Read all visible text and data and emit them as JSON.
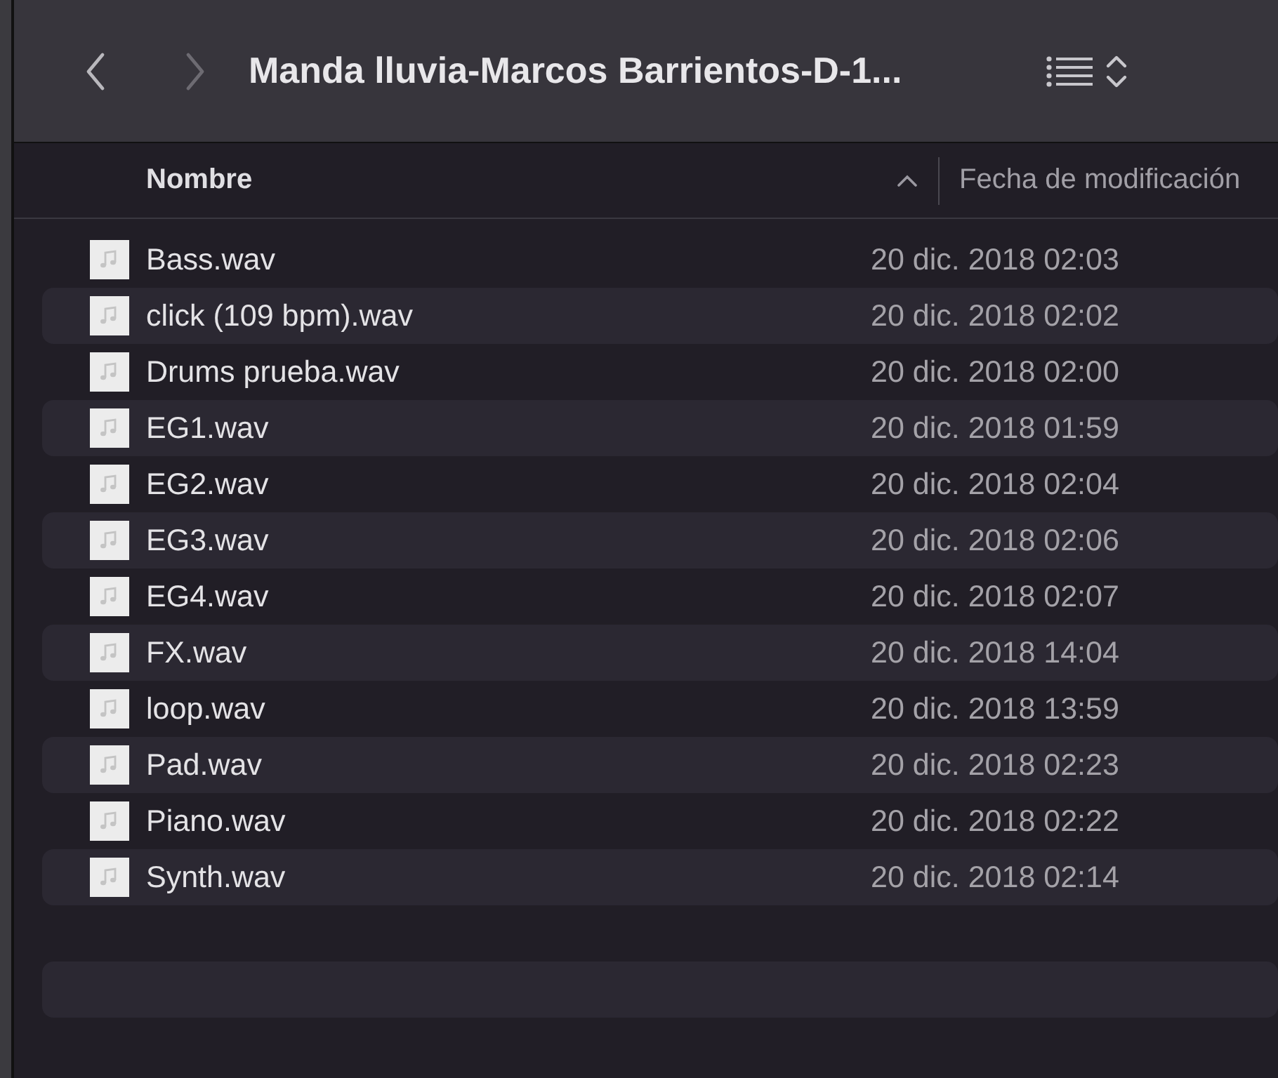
{
  "toolbar": {
    "back": {
      "disabled": false
    },
    "forward": {
      "disabled": true
    },
    "title": "Manda lluvia-Marcos Barrientos-D-1..."
  },
  "columns": [
    {
      "label": "Nombre",
      "sorted": true
    },
    {
      "label": "Fecha de modificación",
      "sorted": false
    }
  ],
  "rows": [
    {
      "name": "Bass.wav",
      "date": "20 dic. 2018 02:03"
    },
    {
      "name": "click (109 bpm).wav",
      "date": "20 dic. 2018 02:02"
    },
    {
      "name": "Drums prueba.wav",
      "date": "20 dic. 2018 02:00"
    },
    {
      "name": "EG1.wav",
      "date": "20 dic. 2018 01:59"
    },
    {
      "name": "EG2.wav",
      "date": "20 dic. 2018 02:04"
    },
    {
      "name": "EG3.wav",
      "date": "20 dic. 2018 02:06"
    },
    {
      "name": "EG4.wav",
      "date": "20 dic. 2018 02:07"
    },
    {
      "name": "FX.wav",
      "date": "20 dic. 2018 14:04"
    },
    {
      "name": "loop.wav",
      "date": "20 dic. 2018 13:59"
    },
    {
      "name": "Pad.wav",
      "date": "20 dic. 2018 02:23"
    },
    {
      "name": "Piano.wav",
      "date": "20 dic. 2018 02:22"
    },
    {
      "name": "Synth.wav",
      "date": "20 dic. 2018 02:14"
    }
  ]
}
